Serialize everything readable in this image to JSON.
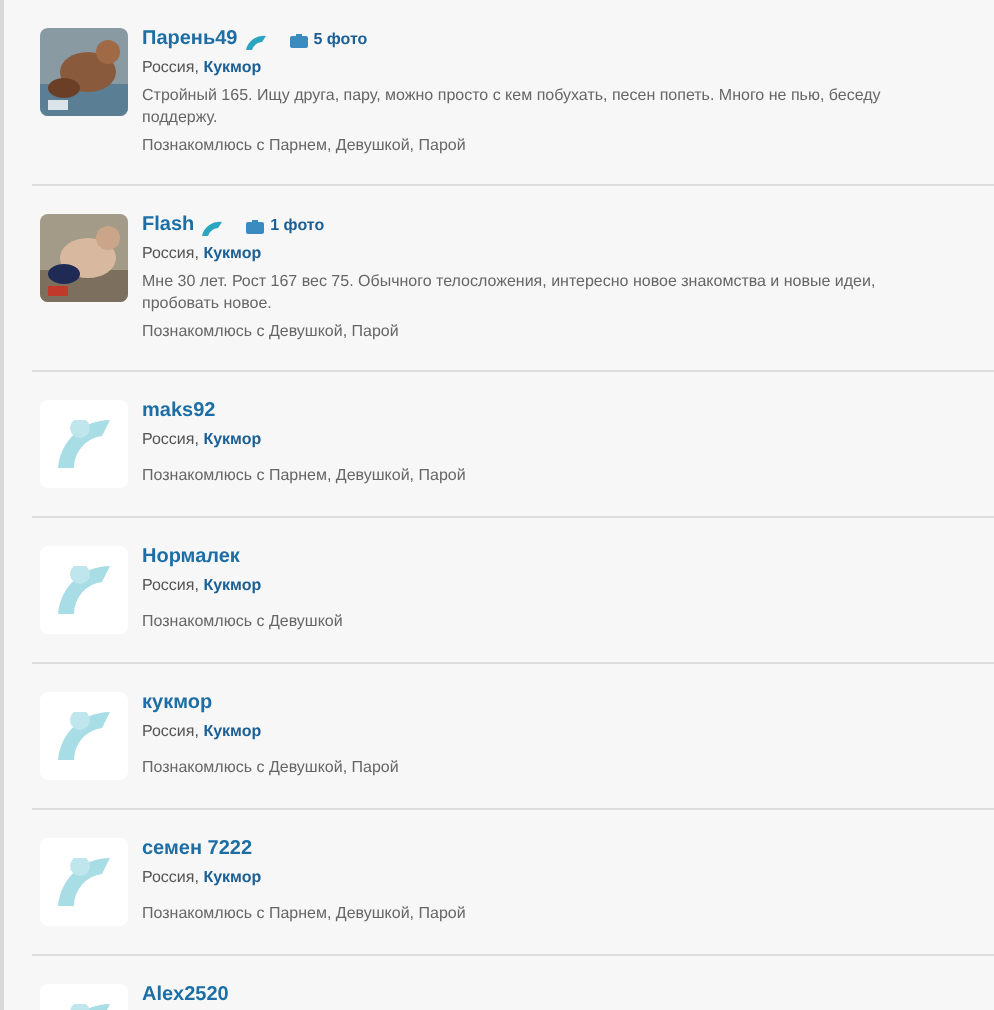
{
  "profiles": [
    {
      "name": "Парень49",
      "online": true,
      "photos": "5 фото",
      "country": "Россия, ",
      "city": "Кукмор",
      "about": "Стройный 165. Ищу друга, пару, можно просто с кем побухать, песен попеть. Много не пью, беседу поддержу.",
      "seeking": "Познакомлюсь с Парнем, Девушкой, Парой"
    },
    {
      "name": "Flash",
      "online": true,
      "photos": "1 фото",
      "country": "Россия, ",
      "city": "Кукмор",
      "about": "Мне 30 лет. Рост 167 вес 75. Обычного телосложения, интересно новое знакомства и новые идеи, пробовать новое.",
      "seeking": "Познакомлюсь с Девушкой, Парой"
    },
    {
      "kind": "placeholder",
      "name": "maks92",
      "online": false,
      "country": "Россия, ",
      "city": "Кукмор",
      "seeking": "Познакомлюсь с Парнем, Девушкой, Парой"
    },
    {
      "kind": "placeholder",
      "name": "Нормалек",
      "online": false,
      "country": "Россия, ",
      "city": "Кукмор",
      "seeking": "Познакомлюсь с Девушкой"
    },
    {
      "kind": "placeholder",
      "name": "кукмор",
      "online": false,
      "country": "Россия, ",
      "city": "Кукмор",
      "seeking": "Познакомлюсь с Девушкой, Парой"
    },
    {
      "kind": "placeholder",
      "name": "семен 7222",
      "online": false,
      "country": "Россия, ",
      "city": "Кукмор",
      "seeking": "Познакомлюсь с Парнем, Девушкой, Парой"
    },
    {
      "kind": "placeholder",
      "name": "Alex2520",
      "online": false
    }
  ]
}
